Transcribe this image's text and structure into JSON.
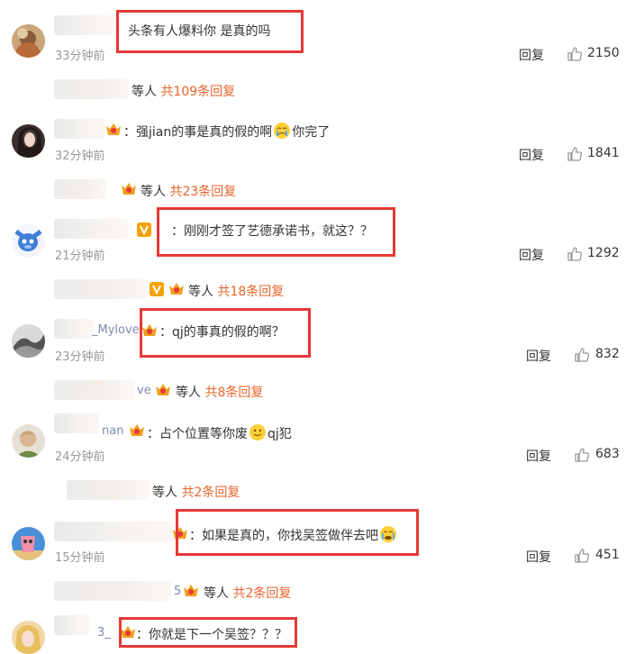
{
  "comments": [
    {
      "text": "头条有人爆料你 是真的吗",
      "time": "33分钟前",
      "reply": "回复",
      "likes": "2150",
      "sub": {
        "name_suffix": "",
        "etc": "等人",
        "count": "共109条回复"
      }
    },
    {
      "text": "强jian的事是真的假的啊",
      "text_after": "你完了",
      "time": "32分钟前",
      "reply": "回复",
      "likes": "1841",
      "sub": {
        "name_suffix": "",
        "etc": "等人",
        "count": "共23条回复"
      }
    },
    {
      "text": "刚刚才签了艺德承诺书，就这？？",
      "time": "21分钟前",
      "reply": "回复",
      "likes": "1292",
      "sub": {
        "name_suffix": "",
        "etc": "等人",
        "count": "共18条回复"
      }
    },
    {
      "name": "_Mylove",
      "text": "qj的事真的假的啊？",
      "time": "23分钟前",
      "reply": "回复",
      "likes": "832",
      "sub": {
        "name_suffix": "ve",
        "etc": "等人",
        "count": "共8条回复"
      }
    },
    {
      "name": "nan",
      "text": "占个位置等你废",
      "text_after": "qj犯",
      "time": "24分钟前",
      "reply": "回复",
      "likes": "683",
      "sub": {
        "name_suffix": "",
        "etc": "等人",
        "count": "共2条回复"
      }
    },
    {
      "text": "如果是真的，你找吴签做伴去吧",
      "time": "15分钟前",
      "reply": "回复",
      "likes": "451",
      "sub": {
        "name_suffix": "5",
        "etc": "等人",
        "count": "共2条回复"
      }
    },
    {
      "name": "3_",
      "text": "你就是下一个吴签？？？"
    }
  ],
  "icons": {
    "like": "thumbs-up-icon",
    "vip": "vip-badge-icon",
    "fan": "fan-crown-icon",
    "emoji": "emoji-icon"
  },
  "colors": {
    "highlight": "#e53935",
    "reply_count": "#e8642a",
    "username": "#7d8ab0",
    "time": "#999999"
  }
}
